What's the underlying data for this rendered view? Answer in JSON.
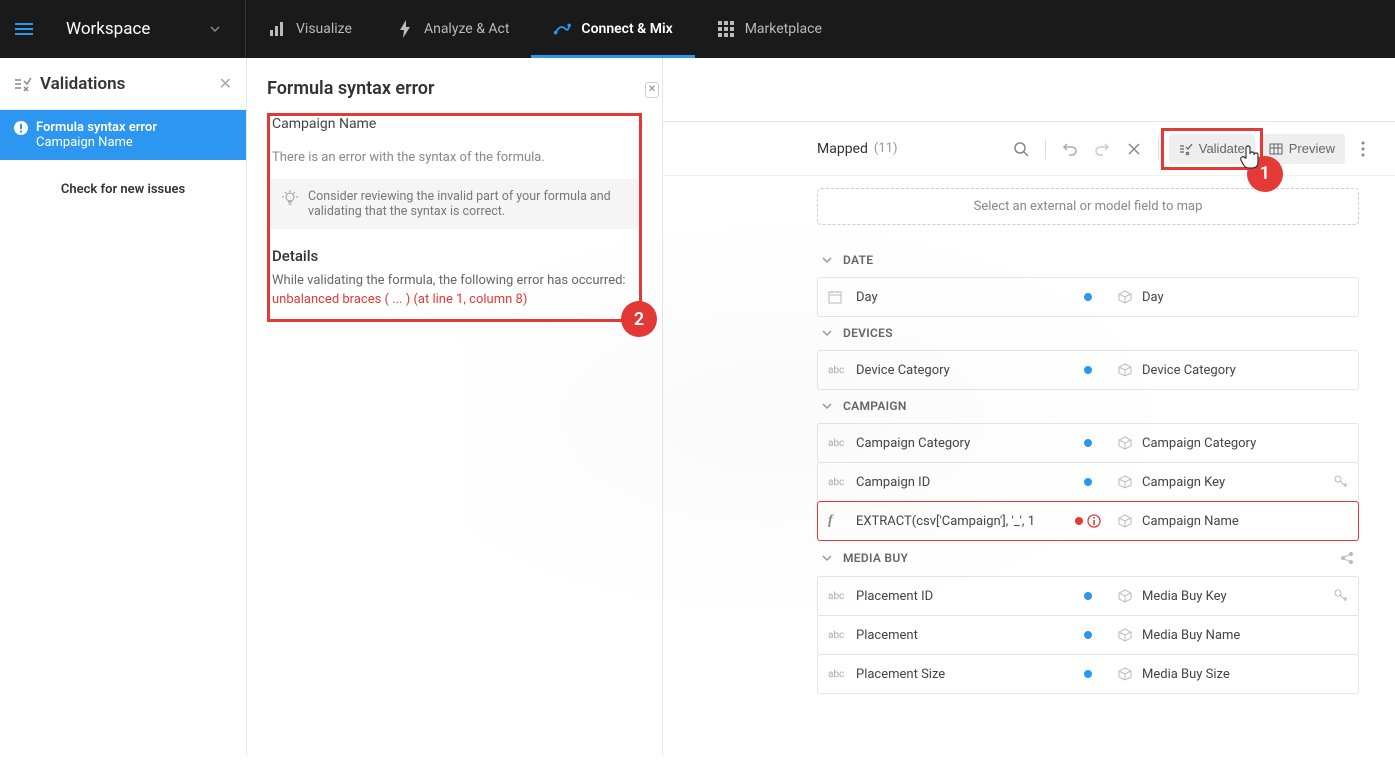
{
  "header": {
    "workspace_label": "Workspace",
    "tabs": [
      {
        "id": "visualize",
        "label": "Visualize"
      },
      {
        "id": "analyze",
        "label": "Analyze & Act"
      },
      {
        "id": "connect",
        "label": "Connect & Mix"
      },
      {
        "id": "marketplace",
        "label": "Marketplace"
      }
    ]
  },
  "validations": {
    "panel_title": "Validations",
    "item": {
      "title": "Formula syntax error",
      "subtitle": "Campaign Name"
    },
    "check_label": "Check for new issues"
  },
  "details": {
    "heading": "Formula syntax error",
    "field_name": "Campaign Name",
    "description": "There is an error with the syntax of the formula.",
    "tip": "Consider reviewing the invalid part of your formula and validating that the syntax is correct.",
    "details_heading": "Details",
    "details_text": "While validating the formula, the following error has occurred:",
    "error_code": "unbalanced braces ( ... ) (at line 1, column 8)"
  },
  "callouts": {
    "one": "1",
    "two": "2"
  },
  "mapping": {
    "mapped_label": "Mapped",
    "mapped_count": "(11)",
    "validate_label": "Validate",
    "preview_label": "Preview",
    "drop_hint": "Select an external or model field to map",
    "groups": [
      {
        "name": "DATE",
        "rows": [
          {
            "type_icon": "cal",
            "source": "Day",
            "target": "Day"
          }
        ]
      },
      {
        "name": "DEVICES",
        "rows": [
          {
            "type_icon": "abc",
            "source": "Device Category",
            "target": "Device Category"
          }
        ]
      },
      {
        "name": "CAMPAIGN",
        "rows": [
          {
            "type_icon": "abc",
            "source": "Campaign Category",
            "target": "Campaign Category"
          },
          {
            "type_icon": "abc",
            "source": "Campaign ID",
            "target": "Campaign Key",
            "has_key": true
          },
          {
            "type_icon": "fx",
            "source": "EXTRACT(csv['Campaign'], '_', 1",
            "target": "Campaign Name",
            "error": true
          }
        ]
      },
      {
        "name": "MEDIA BUY",
        "share": true,
        "rows": [
          {
            "type_icon": "abc",
            "source": "Placement ID",
            "target": "Media Buy Key",
            "has_key": true
          },
          {
            "type_icon": "abc",
            "source": "Placement",
            "target": "Media Buy Name"
          },
          {
            "type_icon": "abc",
            "source": "Placement Size",
            "target": "Media Buy Size"
          }
        ]
      }
    ]
  }
}
